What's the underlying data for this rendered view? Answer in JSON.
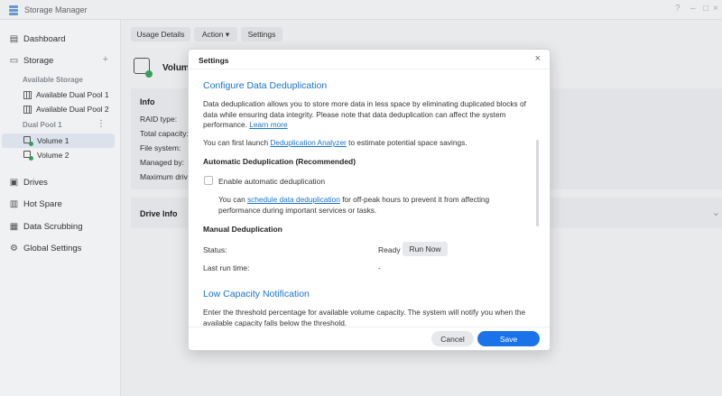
{
  "app": {
    "title": "Storage Manager",
    "help_icon": "question-icon",
    "min_icon": "minimize-icon",
    "max_icon": "maximize-icon",
    "close_icon": "close-icon"
  },
  "sidebar": {
    "dashboard": "Dashboard",
    "storage": "Storage",
    "available_storage": "Available Storage",
    "available_pools": [
      "Available Dual Pool 1",
      "Available Dual Pool 2"
    ],
    "dual_pool": "Dual Pool 1",
    "volumes": [
      "Volume 1",
      "Volume 2"
    ],
    "drives": "Drives",
    "hot_spare": "Hot Spare",
    "data_scrubbing": "Data Scrubbing",
    "global_settings": "Global Settings"
  },
  "toolbar": {
    "usage_details": "Usage Details",
    "action": "Action ▾",
    "settings": "Settings"
  },
  "main": {
    "volume_title": "Volume",
    "info_title": "Info",
    "info_rows": [
      "RAID type:",
      "Total capacity:",
      "File system:",
      "Managed by:",
      "Maximum driv"
    ],
    "drive_info": "Drive Info"
  },
  "dialog": {
    "title": "Settings",
    "dedup_title": "Configure Data Deduplication",
    "dedup_desc": "Data deduplication allows you to store more data in less space by eliminating duplicated blocks of data while ensuring data integrity. Please note that data deduplication can affect the system performance.",
    "learn_more": "Learn more",
    "analyzer_pre": "You can first launch",
    "analyzer_link": "Deduplication Analyzer",
    "analyzer_post": "to estimate potential space savings.",
    "auto_title": "Automatic Deduplication (Recommended)",
    "enable_auto": "Enable automatic deduplication",
    "schedule_pre": "You can",
    "schedule_link": "schedule data deduplication",
    "schedule_post": "for off-peak hours to prevent it from affecting performance during important services or tasks.",
    "manual_title": "Manual Deduplication",
    "status_label": "Status:",
    "status_value": "Ready",
    "run_now": "Run Now",
    "last_run_label": "Last run time:",
    "last_run_value": "-",
    "low_cap_title": "Low Capacity Notification",
    "low_cap_desc": "Enter the threshold percentage for available volume capacity. The system will notify you when the available capacity falls below the threshold.",
    "cancel": "Cancel",
    "save": "Save"
  },
  "colors": {
    "accent": "#1a73e8",
    "link": "#1a73c8",
    "healthy": "#3aa55d"
  }
}
